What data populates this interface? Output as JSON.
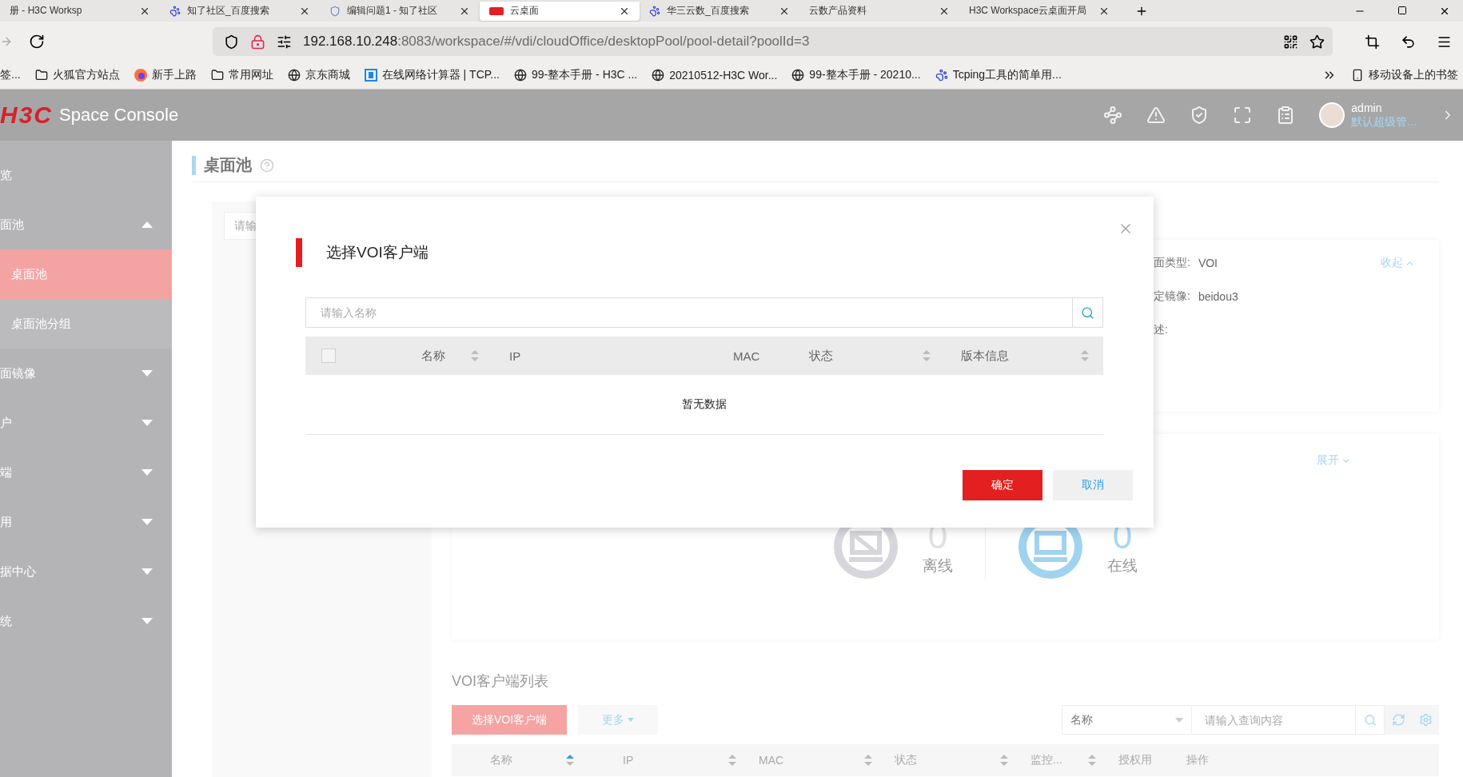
{
  "browser": {
    "tabs": [
      {
        "label": "册 - H3C Worksp",
        "kind": "plain",
        "selected": false
      },
      {
        "label": "知了社区_百度搜索",
        "kind": "paw",
        "selected": false
      },
      {
        "label": "编辑问题1 - 知了社区",
        "kind": "shield",
        "selected": false
      },
      {
        "label": "云桌面",
        "kind": "logo",
        "selected": true
      },
      {
        "label": "华三云数_百度搜索",
        "kind": "paw",
        "selected": false
      },
      {
        "label": "云数产品资料",
        "kind": "plain",
        "selected": false
      },
      {
        "label": "H3C Workspace云桌面开局",
        "kind": "plain",
        "selected": false
      }
    ],
    "address": {
      "host": "192.168.10.248",
      "path": ":8083/workspace/#/vdi/cloudOffice/desktopPool/pool-detail?poolId=3"
    },
    "bookmarks": [
      {
        "label": "签...",
        "kind": "none"
      },
      {
        "label": "火狐官方站点",
        "kind": "folder"
      },
      {
        "label": "新手上路",
        "kind": "firefox"
      },
      {
        "label": "常用网址",
        "kind": "folder"
      },
      {
        "label": "京东商城",
        "kind": "globe"
      },
      {
        "label": "在线网络计算器 | TCP...",
        "kind": "bracket"
      },
      {
        "label": "99-整本手册 - H3C ...",
        "kind": "globe"
      },
      {
        "label": "20210512-H3C Wor...",
        "kind": "globe"
      },
      {
        "label": "99-整本手册 - 20210...",
        "kind": "globe"
      },
      {
        "label": "Tcping工具的简单用...",
        "kind": "paw"
      }
    ],
    "mobile_bookmarks": "移动设备上的书签"
  },
  "header": {
    "logo": "H3C",
    "product": "Space Console",
    "user": {
      "name": "admin",
      "role": "默认超级管..."
    }
  },
  "sidebar": {
    "items": [
      {
        "label": "览",
        "kind": "link"
      },
      {
        "label": "面池",
        "kind": "group",
        "expanded": true,
        "children": [
          {
            "label": "桌面池",
            "selected": true
          },
          {
            "label": "桌面池分组",
            "selected": false
          }
        ]
      },
      {
        "label": "面镜像",
        "kind": "group",
        "expanded": false
      },
      {
        "label": "户",
        "kind": "group",
        "expanded": false
      },
      {
        "label": "端",
        "kind": "group",
        "expanded": false
      },
      {
        "label": "用",
        "kind": "group",
        "expanded": false
      },
      {
        "label": "据中心",
        "kind": "group",
        "expanded": false
      },
      {
        "label": "统",
        "kind": "group",
        "expanded": false
      }
    ]
  },
  "page": {
    "title": "桌面池",
    "left_panel": {
      "search_placeholder": "请输"
    },
    "info_card": {
      "collapse_link": "收起",
      "rows": [
        {
          "label": "面类型:",
          "value": "VOI"
        },
        {
          "label": "定镜像:",
          "value": "beidou3"
        },
        {
          "label": "述:"
        }
      ]
    },
    "status_card": {
      "expand_link": "展开",
      "stats": [
        {
          "kind": "offline",
          "count": "0",
          "label": "离线"
        },
        {
          "kind": "online",
          "count": "0",
          "label": "在线"
        }
      ]
    },
    "client_list": {
      "title": "VOI客户端列表",
      "add_button": "选择VOI客户端",
      "more_button": "更多",
      "filter_field": "名称",
      "search_placeholder": "请输入查询内容",
      "columns": [
        {
          "label": "名称",
          "sortable": true,
          "active": true
        },
        {
          "label": "IP",
          "sortable": true,
          "active": false
        },
        {
          "label": "MAC",
          "sortable": true,
          "active": false
        },
        {
          "label": "状态",
          "sortable": true,
          "active": false
        },
        {
          "label": "监控...",
          "sortable": true,
          "active": false
        },
        {
          "label": "授权用",
          "sortable": false
        },
        {
          "label": "操作",
          "sortable": false
        }
      ]
    }
  },
  "dialog": {
    "title": "选择VOI客户端",
    "search_placeholder": "请输入名称",
    "columns": [
      {
        "label": "名称",
        "sortable": true
      },
      {
        "label": "IP",
        "sortable": false
      },
      {
        "label": "MAC",
        "sortable": false
      },
      {
        "label": "状态",
        "sortable": true
      },
      {
        "label": "版本信息",
        "sortable": true
      }
    ],
    "select_all_checked": false,
    "empty_text": "暂无数据",
    "buttons": [
      {
        "label": "确定",
        "kind": "primary"
      },
      {
        "label": "取消",
        "kind": "secondary"
      }
    ]
  }
}
